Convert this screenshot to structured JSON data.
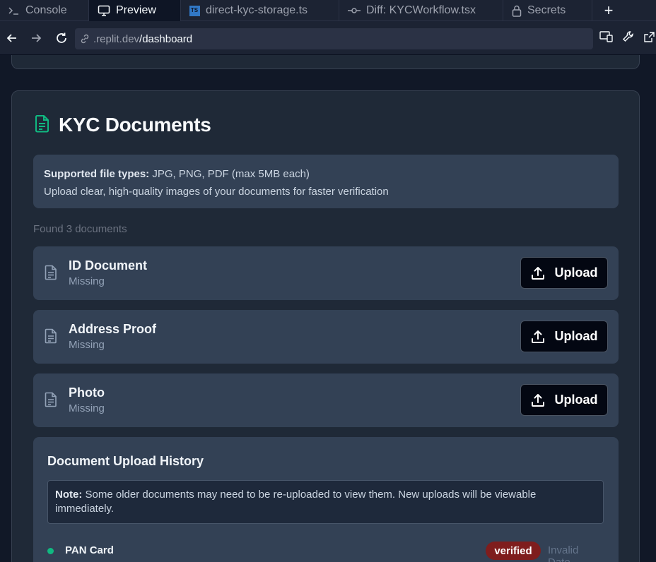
{
  "tabs": [
    {
      "label": "Console",
      "icon": "terminal-icon"
    },
    {
      "label": "Preview",
      "icon": "monitor-icon",
      "active": true
    },
    {
      "label": "direct-kyc-storage.ts",
      "icon": "typescript-file-icon"
    },
    {
      "label": "Diff: KYCWorkflow.tsx",
      "icon": "git-commit-icon"
    },
    {
      "label": "Secrets",
      "icon": "lock-icon"
    }
  ],
  "ts_badge": "TS",
  "new_tab_label": "+",
  "address": {
    "domain": ".replit.dev",
    "path": "/dashboard"
  },
  "kyc": {
    "title": "KYC Documents",
    "info_label": "Supported file types:",
    "info_types": " JPG, PNG, PDF (max 5MB each)",
    "info_hint": "Upload clear, high-quality images of your documents for faster verification",
    "found_text": "Found 3 documents",
    "upload_label": "Upload",
    "documents": [
      {
        "name": "ID Document",
        "status": "Missing"
      },
      {
        "name": "Address Proof",
        "status": "Missing"
      },
      {
        "name": "Photo",
        "status": "Missing"
      }
    ]
  },
  "history": {
    "title": "Document Upload History",
    "note_label": "Note:",
    "note_text": " Some older documents may need to be re-uploaded to view them. New uploads will be viewable immediately.",
    "items": [
      {
        "name": "PAN Card",
        "status": "verified",
        "date": "Invalid Date"
      }
    ]
  },
  "colors": {
    "accent_green": "#10b981",
    "badge_red": "#7f1d1d",
    "typescript_blue": "#3178c6"
  }
}
